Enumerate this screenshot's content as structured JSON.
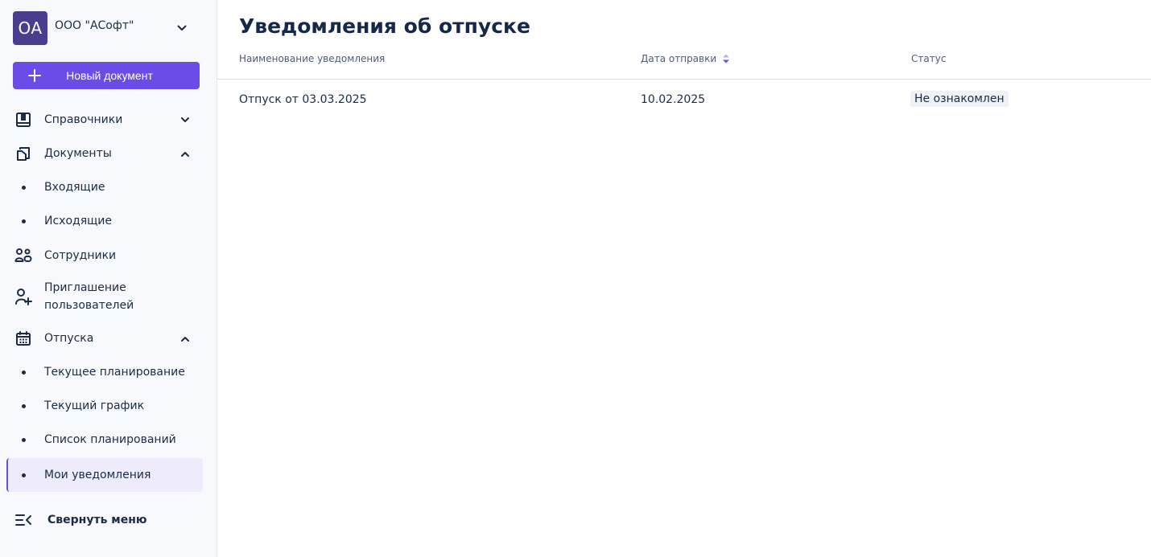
{
  "sidebar": {
    "org": {
      "initials": "OA",
      "name": "ООО \"АСофт\""
    },
    "new_document_label": "Новый документ",
    "items": [
      {
        "label": "Справочники"
      },
      {
        "label": "Документы"
      },
      {
        "label": "Входящие"
      },
      {
        "label": "Исходящие"
      },
      {
        "label": "Сотрудники"
      },
      {
        "label": "Приглашение пользователей"
      },
      {
        "label": "Отпуска"
      },
      {
        "label": "Текущее планирование"
      },
      {
        "label": "Текущий график"
      },
      {
        "label": "Список планирований"
      },
      {
        "label": "Мои уведомления"
      }
    ],
    "collapse_label": "Свернуть меню",
    "icons": {
      "directories": "book-icon",
      "documents": "documents-icon",
      "employees": "users-icon",
      "invite": "user-plus-icon",
      "vacations": "calendar-icon",
      "collapse": "menu-collapse-icon"
    }
  },
  "main": {
    "title": "Уведомления об отпуске",
    "columns": {
      "name": "Наименование уведомления",
      "date": "Дата отправки",
      "status": "Статус"
    },
    "rows": [
      {
        "name": "Отпуск от 03.03.2025",
        "date": "10.02.2025",
        "status": "Не ознакомлен"
      }
    ]
  },
  "colors": {
    "accent": "#6c4ce6",
    "avatar": "#4a3d8f",
    "active_bg": "#eeebfc",
    "text": "#1b2b44"
  }
}
